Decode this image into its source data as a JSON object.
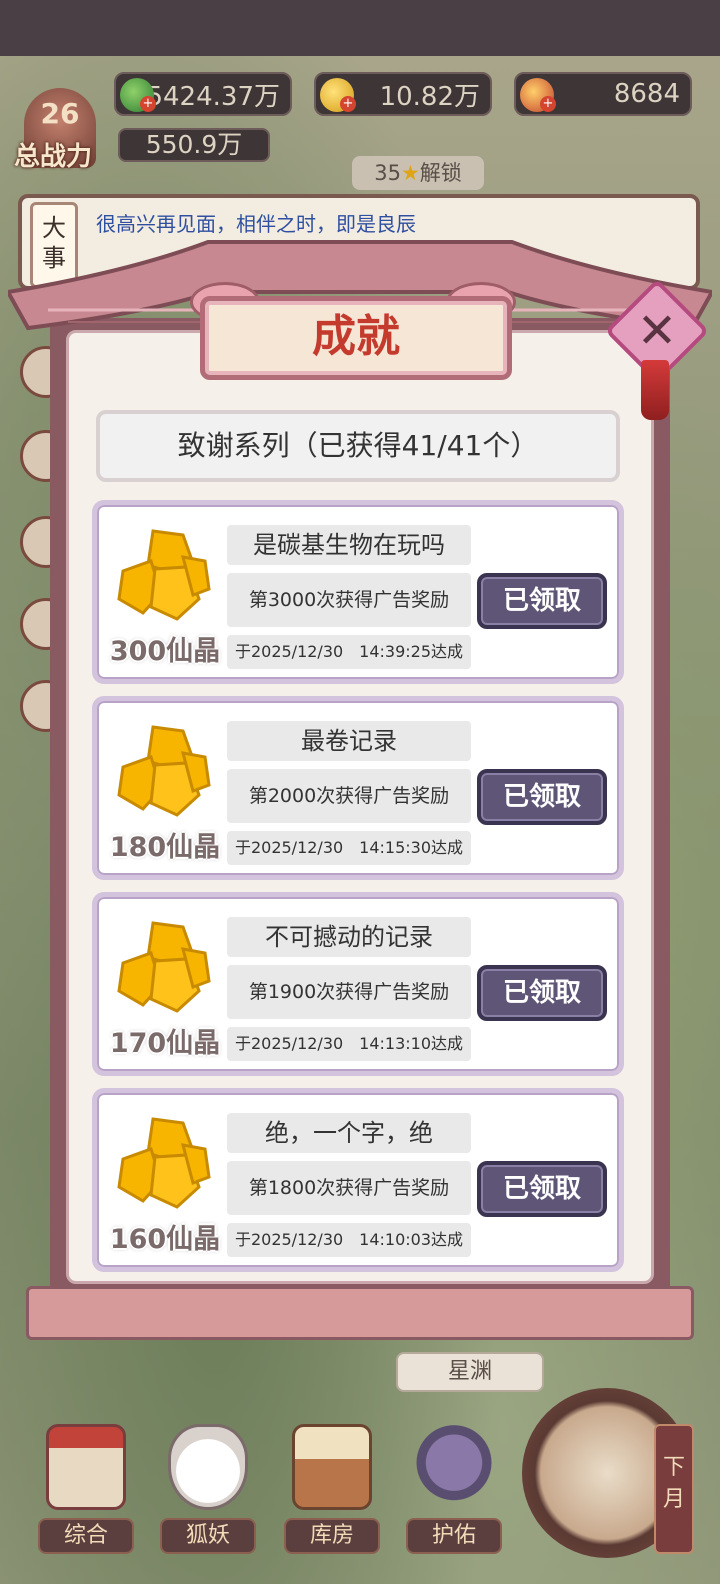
{
  "resources": {
    "jade": "5424.37万",
    "gold": "10.82万",
    "fruit": "8684"
  },
  "player": {
    "level": "26",
    "power_label": "总战力",
    "power_value": "550.9万"
  },
  "unlock": {
    "stars": "35",
    "label": "解锁"
  },
  "news": {
    "tag": "大事",
    "text": "很高兴再见面，相伴之时，即是良辰"
  },
  "modal": {
    "title": "成就",
    "close_glyph": "✕",
    "series": "致谢系列（已获得41/41个）"
  },
  "achievements": [
    {
      "title": "是碳基生物在玩吗",
      "desc": "第3000次获得广告奖励",
      "date": "于2025/12/30　14:39:25达成",
      "reward": "300仙晶",
      "button": "已领取"
    },
    {
      "title": "最卷记录",
      "desc": "第2000次获得广告奖励",
      "date": "于2025/12/30　14:15:30达成",
      "reward": "180仙晶",
      "button": "已领取"
    },
    {
      "title": "不可撼动的记录",
      "desc": "第1900次获得广告奖励",
      "date": "于2025/12/30　14:13:10达成",
      "reward": "170仙晶",
      "button": "已领取"
    },
    {
      "title": "绝，一个字，绝",
      "desc": "第1800次获得广告奖励",
      "date": "于2025/12/30　14:10:03达成",
      "reward": "160仙晶",
      "button": "已领取"
    }
  ],
  "place": "星渊",
  "nav": [
    {
      "label": "综合",
      "icon": "gate-icon"
    },
    {
      "label": "狐妖",
      "icon": "fox-mask-icon"
    },
    {
      "label": "库房",
      "icon": "storehouse-icon"
    },
    {
      "label": "护佑",
      "icon": "lotus-icon"
    }
  ],
  "next_month": "下月",
  "colors": {
    "accent": "#b26c77",
    "button": "#5f5577",
    "title_red": "#c43b2e"
  }
}
